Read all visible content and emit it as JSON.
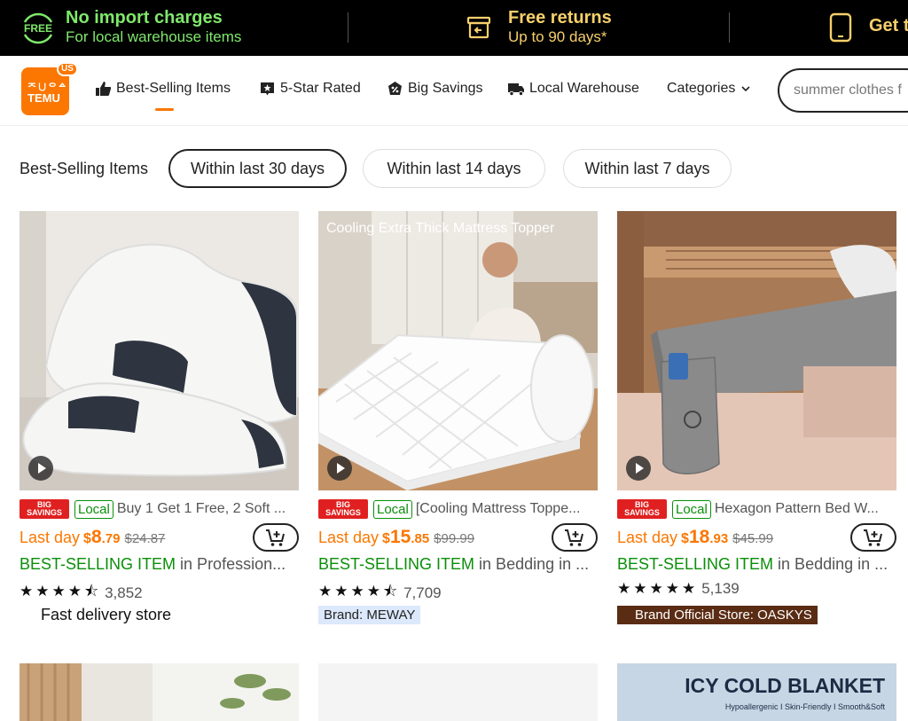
{
  "promo": {
    "free_badge": "FREE",
    "import_title": "No import charges",
    "import_sub": "For local warehouse items",
    "returns_title": "Free returns",
    "returns_sub": "Up to 90 days*",
    "app_title": "Get t"
  },
  "header": {
    "logo_glyphs": "ᄌ∪ᄋᅀ",
    "logo_word": "TEMU",
    "logo_region": "US",
    "nav": [
      {
        "label": "Best-Selling Items",
        "icon": "thumbs-up-icon"
      },
      {
        "label": "5-Star Rated",
        "icon": "star-badge-icon"
      },
      {
        "label": "Big Savings",
        "icon": "discount-tag-icon"
      },
      {
        "label": "Local Warehouse",
        "icon": "truck-icon"
      },
      {
        "label": "Categories",
        "icon": "chevron-down-icon"
      }
    ],
    "search_placeholder": "summer clothes f"
  },
  "filters": {
    "label": "Best-Selling Items",
    "options": [
      "Within last 30 days",
      "Within last 14 days",
      "Within last 7 days"
    ],
    "selected": "Within last 30 days"
  },
  "products": [
    {
      "badge": "BIG SAVINGS",
      "local": "Local",
      "title": "Buy 1 Get 1 Free, 2 Soft ...",
      "last_day": "Last day",
      "currency": "$",
      "price_main": "8",
      "price_cents": ".79",
      "old_price": "$24.87",
      "best": "BEST-SELLING ITEM",
      "best_rest": " in Profession...",
      "stars": "★★★★⯪",
      "reviews": "3,852",
      "store": "Fast delivery store"
    },
    {
      "caption": "Cooling Extra Thick Mattress Topper",
      "badge": "BIG SAVINGS",
      "local": "Local",
      "title": "[Cooling Mattress Toppe...",
      "last_day": "Last day",
      "currency": "$",
      "price_main": "15",
      "price_cents": ".85",
      "old_price": "$99.99",
      "best": "BEST-SELLING ITEM",
      "best_rest": " in Bedding in ...",
      "stars": "★★★★⯪",
      "reviews": "7,709",
      "store": "Brand: MEWAY"
    },
    {
      "badge": "BIG SAVINGS",
      "local": "Local",
      "title": "Hexagon Pattern Bed W...",
      "last_day": "Last day",
      "currency": "$",
      "price_main": "18",
      "price_cents": ".93",
      "old_price": "$45.99",
      "best": "BEST-SELLING ITEM",
      "best_rest": " in Bedding in ...",
      "stars": "★★★★★",
      "reviews": "5,139",
      "store": "Brand Official Store: OASKYS"
    }
  ],
  "next_row": {
    "banner_title": "ICY COLD BLANKET",
    "banner_sub": "Hypoallergenic  I  Skin-Friendly  I  Smooth&Soft"
  },
  "colors": {
    "brand_orange": "#fb7701",
    "green": "#0a8f08",
    "promo_green": "#7fe86b",
    "promo_yellow": "#f7d06b",
    "badge_red": "#e02020"
  }
}
